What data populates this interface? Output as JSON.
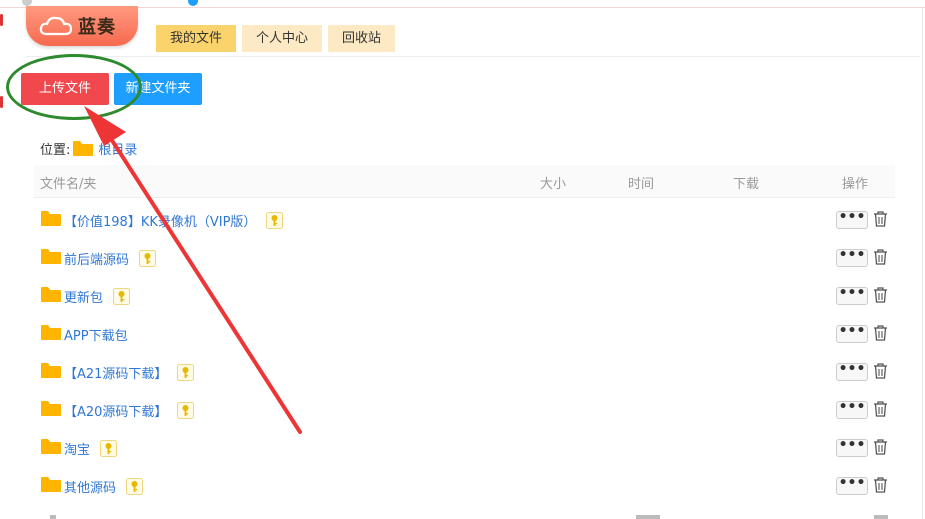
{
  "logo": {
    "text": "蓝奏"
  },
  "nav": {
    "tabs": [
      {
        "label": "我的文件",
        "active": true
      },
      {
        "label": "个人中心",
        "active": false
      },
      {
        "label": "回收站",
        "active": false
      }
    ]
  },
  "toolbar": {
    "upload_label": "上传文件",
    "new_folder_label": "新建文件夹"
  },
  "location": {
    "label": "位置:",
    "root": "根目录"
  },
  "table": {
    "headers": {
      "name": "文件名/夹",
      "size": "大小",
      "time": "时间",
      "download": "下载",
      "action": "操作"
    },
    "rows": [
      {
        "name": "【价值198】KK录像机（VIP版）",
        "locked": true
      },
      {
        "name": "前后端源码",
        "locked": true
      },
      {
        "name": "更新包",
        "locked": true
      },
      {
        "name": "APP下载包",
        "locked": false
      },
      {
        "name": "【A21源码下载】",
        "locked": true
      },
      {
        "name": "【A20源码下载】",
        "locked": true
      },
      {
        "name": "淘宝",
        "locked": true
      },
      {
        "name": "其他源码",
        "locked": true
      }
    ],
    "more_label": "•••"
  },
  "icons": {
    "logo": "cloud-icon",
    "folder": "folder-icon",
    "lock": "key-icon",
    "delete": "trash-icon",
    "more": "more-icon"
  },
  "colors": {
    "upload": "#f0484d",
    "new_folder": "#1e9fff",
    "nav_active": "#fbd36c",
    "nav_inactive": "#fde9c4",
    "link": "#2f77d6",
    "folder": "#ffb400",
    "annotation_ring": "#2d8a2d",
    "annotation_arrow": "#ee3535"
  }
}
